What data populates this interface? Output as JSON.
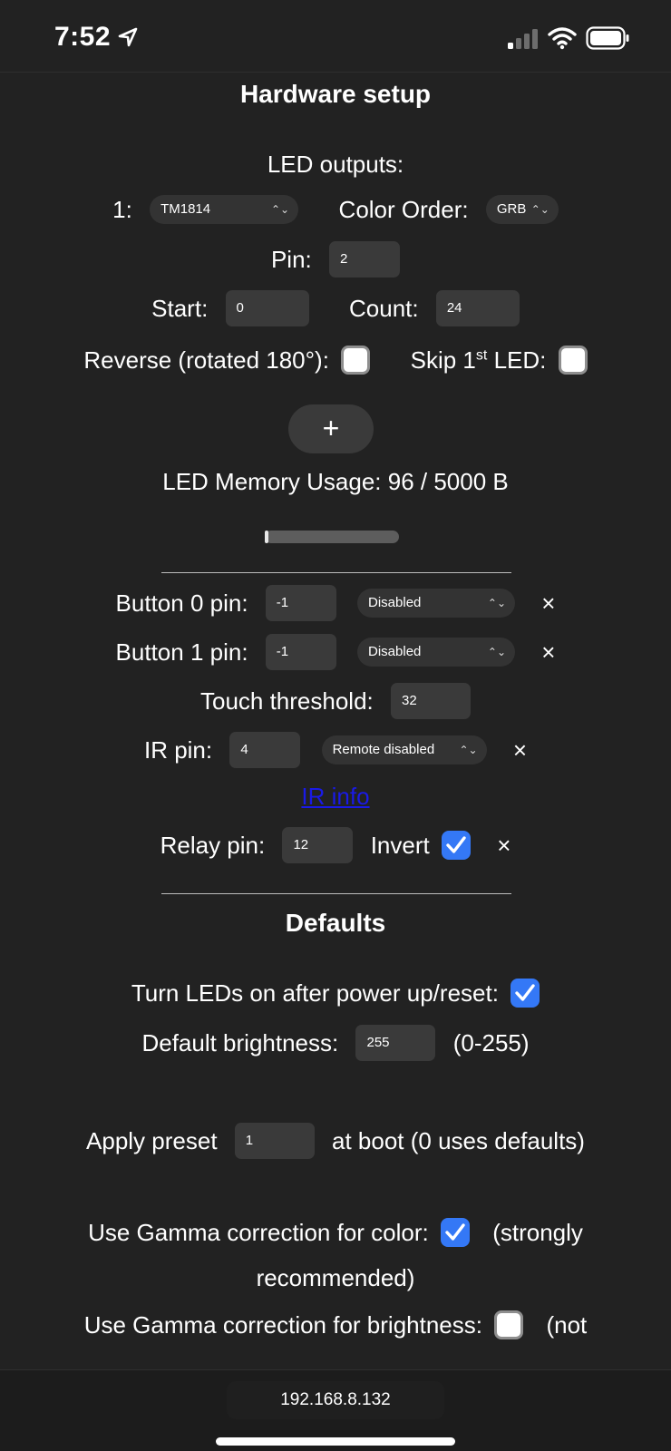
{
  "status": {
    "time": "7:52"
  },
  "hardware": {
    "title": "Hardware setup",
    "led_outputs_label": "LED outputs:",
    "output_index": "1:",
    "led_type": "TM1814",
    "color_order_label": "Color Order:",
    "color_order": "GRB",
    "pin_label": "Pin:",
    "pin": "2",
    "start_label": "Start:",
    "start": "0",
    "count_label": "Count:",
    "count": "24",
    "reverse_label": "Reverse (rotated 180°):",
    "reverse_checked": false,
    "skip_label_pre": "Skip 1",
    "skip_label_sup": "st",
    "skip_label_post": " LED:",
    "skip_checked": false,
    "add_label": "+",
    "memory_usage": "LED Memory Usage: 96 / 5000 B",
    "memory_fraction": 0.019
  },
  "inputs": {
    "button0_label": "Button 0 pin:",
    "button0_pin": "-1",
    "button0_mode": "Disabled",
    "button1_label": "Button 1 pin:",
    "button1_pin": "-1",
    "button1_mode": "Disabled",
    "touch_label": "Touch threshold:",
    "touch_value": "32",
    "ir_label": "IR pin:",
    "ir_pin": "4",
    "ir_mode": "Remote disabled",
    "ir_info_link": "IR info",
    "relay_label": "Relay pin:",
    "relay_pin": "12",
    "invert_label": "Invert",
    "invert_checked": true,
    "clear_glyph": "×"
  },
  "defaults": {
    "title": "Defaults",
    "turn_on_label": "Turn LEDs on after power up/reset:",
    "turn_on_checked": true,
    "brightness_label": "Default brightness:",
    "brightness": "255",
    "brightness_range": "(0-255)",
    "apply_preset_label": "Apply preset",
    "apply_preset": "1",
    "apply_preset_suffix": "at boot (0 uses defaults)",
    "gamma_color_label": "Use Gamma correction for color:",
    "gamma_color_checked": true,
    "gamma_color_note_1": "(strongly",
    "gamma_color_note_2": "recommended)",
    "gamma_bri_label": "Use Gamma correction for brightness:",
    "gamma_bri_checked": false,
    "gamma_bri_note": "(not"
  },
  "browser": {
    "url": "192.168.8.132"
  },
  "colors": {
    "background": "#222222",
    "accent": "#3478f6",
    "link": "#1a1ae6",
    "field": "#3a3a3a"
  }
}
